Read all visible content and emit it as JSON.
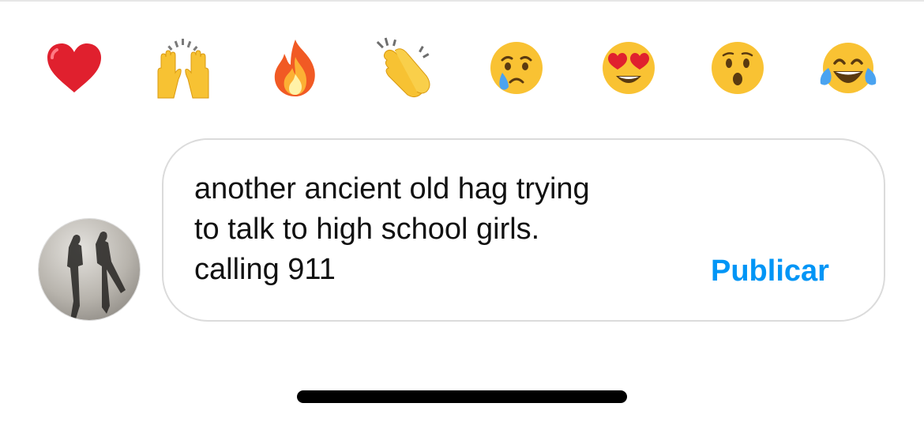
{
  "reactions": [
    {
      "icon": "red-heart-icon",
      "glyph": "❤️"
    },
    {
      "icon": "raising-hands-icon",
      "glyph": "🙌"
    },
    {
      "icon": "fire-icon",
      "glyph": "🔥"
    },
    {
      "icon": "clapping-hands-icon",
      "glyph": "👏"
    },
    {
      "icon": "crying-face-icon",
      "glyph": "😢"
    },
    {
      "icon": "heart-eyes-face-icon",
      "glyph": "😍"
    },
    {
      "icon": "surprised-face-icon",
      "glyph": "😮"
    },
    {
      "icon": "tears-of-joy-face-icon",
      "glyph": "😂"
    }
  ],
  "comment": {
    "text": "another ancient old hag trying\nto talk to high school girls.\ncalling 911",
    "post_label": "Publicar"
  },
  "colors": {
    "accent": "#0095f6",
    "border": "#dbdbdb",
    "text": "#111111"
  }
}
